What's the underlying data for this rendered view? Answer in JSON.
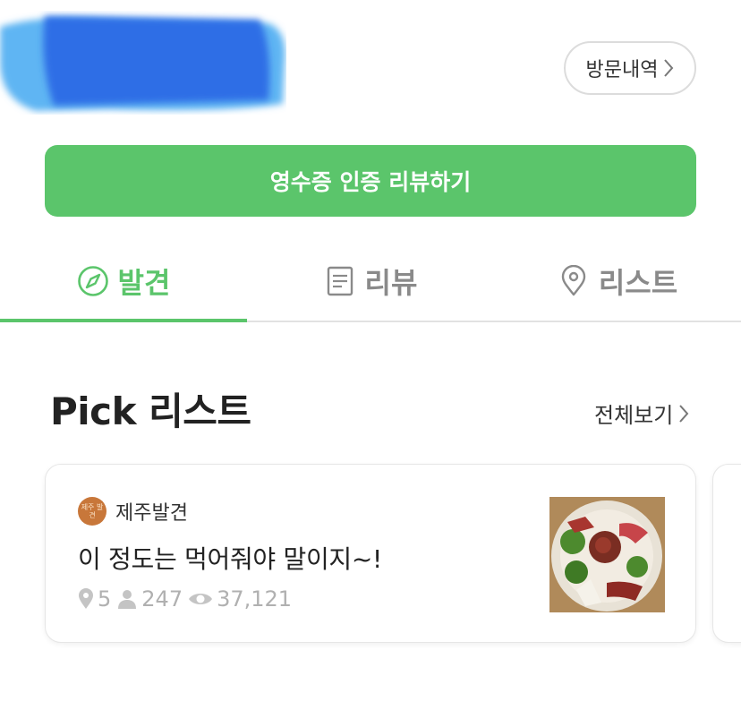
{
  "header": {
    "visit_history_label": "방문내역"
  },
  "review_button_label": "영수증 인증 리뷰하기",
  "tabs": [
    {
      "label": "발견",
      "icon": "compass-icon",
      "active": true
    },
    {
      "label": "리뷰",
      "icon": "document-icon",
      "active": false
    },
    {
      "label": "리스트",
      "icon": "location-pin-icon",
      "active": false
    }
  ],
  "section": {
    "title": "Pick 리스트",
    "see_all_label": "전체보기"
  },
  "card": {
    "author_avatar_text": "제주 발견",
    "author_name": "제주발견",
    "title": "이 정도는 먹어줘야 말이지~!",
    "stats": {
      "places": "5",
      "followers": "247",
      "views": "37,121"
    }
  },
  "colors": {
    "accent": "#5bc56b",
    "muted": "#8a8a8a",
    "stat_gray": "#b0b0b0"
  }
}
